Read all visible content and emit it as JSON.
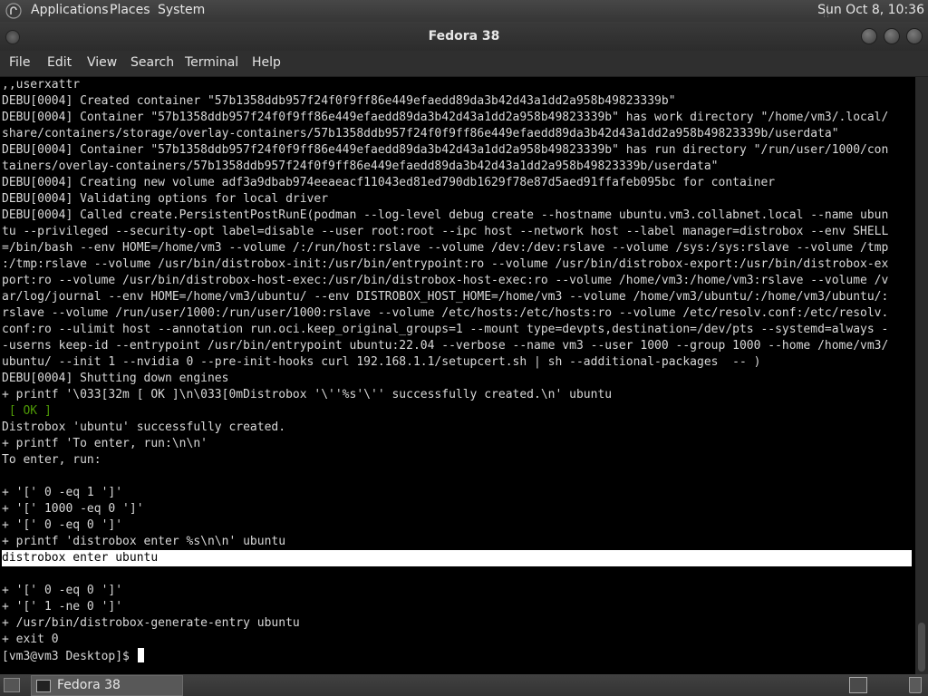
{
  "top_panel": {
    "applications": "Applications",
    "places": "Places",
    "system": "System",
    "clock": "Sun Oct  8, 10:36"
  },
  "window": {
    "title": "Fedora 38"
  },
  "menubar": {
    "file": "File",
    "edit": "Edit",
    "view": "View",
    "search": "Search",
    "terminal": "Terminal",
    "help": "Help"
  },
  "terminal": {
    "lines": [
      ",,userxattr",
      "DEBU[0004] Created container \"57b1358ddb957f24f0f9ff86e449efaedd89da3b42d43a1dd2a958b49823339b\"",
      "DEBU[0004] Container \"57b1358ddb957f24f0f9ff86e449efaedd89da3b42d43a1dd2a958b49823339b\" has work directory \"/home/vm3/.local/",
      "share/containers/storage/overlay-containers/57b1358ddb957f24f0f9ff86e449efaedd89da3b42d43a1dd2a958b49823339b/userdata\"",
      "DEBU[0004] Container \"57b1358ddb957f24f0f9ff86e449efaedd89da3b42d43a1dd2a958b49823339b\" has run directory \"/run/user/1000/con",
      "tainers/overlay-containers/57b1358ddb957f24f0f9ff86e449efaedd89da3b42d43a1dd2a958b49823339b/userdata\"",
      "DEBU[0004] Creating new volume adf3a9dbab974eeaeacf11043ed81ed790db1629f78e87d5aed91ffafeb095bc for container",
      "DEBU[0004] Validating options for local driver",
      "DEBU[0004] Called create.PersistentPostRunE(podman --log-level debug create --hostname ubuntu.vm3.collabnet.local --name ubun",
      "tu --privileged --security-opt label=disable --user root:root --ipc host --network host --label manager=distrobox --env SHELL",
      "=/bin/bash --env HOME=/home/vm3 --volume /:/run/host:rslave --volume /dev:/dev:rslave --volume /sys:/sys:rslave --volume /tmp",
      ":/tmp:rslave --volume /usr/bin/distrobox-init:/usr/bin/entrypoint:ro --volume /usr/bin/distrobox-export:/usr/bin/distrobox-ex",
      "port:ro --volume /usr/bin/distrobox-host-exec:/usr/bin/distrobox-host-exec:ro --volume /home/vm3:/home/vm3:rslave --volume /v",
      "ar/log/journal --env HOME=/home/vm3/ubuntu/ --env DISTROBOX_HOST_HOME=/home/vm3 --volume /home/vm3/ubuntu/:/home/vm3/ubuntu/:",
      "rslave --volume /run/user/1000:/run/user/1000:rslave --volume /etc/hosts:/etc/hosts:ro --volume /etc/resolv.conf:/etc/resolv.",
      "conf:ro --ulimit host --annotation run.oci.keep_original_groups=1 --mount type=devpts,destination=/dev/pts --systemd=always -",
      "-userns keep-id --entrypoint /usr/bin/entrypoint ubuntu:22.04 --verbose --name vm3 --user 1000 --group 1000 --home /home/vm3/",
      "ubuntu/ --init 1 --nvidia 0 --pre-init-hooks curl 192.168.1.1/setupcert.sh | sh --additional-packages  -- )",
      "DEBU[0004] Shutting down engines",
      "+ printf '\\033[32m [ OK ]\\n\\033[0mDistrobox '\\''%s'\\'' successfully created.\\n' ubuntu",
      " [ OK ]",
      "Distrobox 'ubuntu' successfully created.",
      "+ printf 'To enter, run:\\n\\n'",
      "To enter, run:",
      "",
      "+ '[' 0 -eq 1 ']'",
      "+ '[' 1000 -eq 0 ']'",
      "+ '[' 0 -eq 0 ']'",
      "+ printf 'distrobox enter %s\\n\\n' ubuntu",
      "distrobox enter ubuntu",
      "",
      "+ '[' 0 -eq 0 ']'",
      "+ '[' 1 -ne 0 ']'",
      "+ /usr/bin/distrobox-generate-entry ubuntu",
      "+ exit 0"
    ],
    "ok_line_index": 20,
    "highlighted_line_index": 29,
    "prompt": "[vm3@vm3 Desktop]$ ",
    "ok_color": "#4e9a06"
  },
  "taskbar": {
    "item_label": "Fedora 38"
  }
}
